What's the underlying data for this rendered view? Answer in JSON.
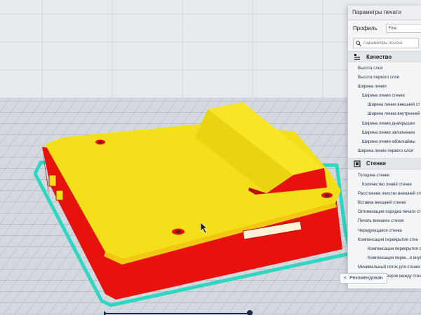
{
  "window": {
    "title": "Параметры печати"
  },
  "profile": {
    "label": "Профиль",
    "value": "Fine"
  },
  "search": {
    "placeholder": "Параметры поиска"
  },
  "sections": [
    {
      "title": "Качество",
      "icon": "quality-icon",
      "items": [
        {
          "label": "Высота слоя",
          "level": 0
        },
        {
          "label": "Высота первого слоя",
          "level": 0
        },
        {
          "label": "Ширина линии",
          "level": 0
        },
        {
          "label": "Ширина линии стенки",
          "level": 1
        },
        {
          "label": "Ширина линии внешней ст",
          "level": 2
        },
        {
          "label": "Ширина линии внутренней",
          "level": 2
        },
        {
          "label": "Ширина линии дна/крышки",
          "level": 1
        },
        {
          "label": "Ширина линии заполнения",
          "level": 1
        },
        {
          "label": "Ширина линии юбки/каймы",
          "level": 1
        },
        {
          "label": "Ширина линии первого слоя",
          "level": 0
        }
      ]
    },
    {
      "title": "Стенки",
      "icon": "walls-icon",
      "items": [
        {
          "label": "Толщина стенки",
          "level": 0
        },
        {
          "label": "Количество линий стенки",
          "level": 1
        },
        {
          "label": "Расстояние очистки внешней стенки",
          "level": 0
        },
        {
          "label": "Вставка внешней стенки",
          "level": 0
        },
        {
          "label": "Оптимизация порядка печати стенок",
          "level": 0
        },
        {
          "label": "Печать внешних стенок",
          "level": 0
        },
        {
          "label": "Чередующаяся стенка",
          "level": 0
        },
        {
          "label": "Компенсация перекрытия стен",
          "level": 0
        },
        {
          "label": "Компенсация перекрытия стен",
          "level": 2
        },
        {
          "label": "Компенсация перек...я внутренних",
          "level": 2
        },
        {
          "label": "Минимальный поток для стенки",
          "level": 0
        },
        {
          "label": "Заполнение зазоров между стенками",
          "level": 0
        }
      ]
    }
  ],
  "footer": {
    "recommended_label": "Рекомендован"
  },
  "colors": {
    "model_top": "#f5e11a",
    "model_side": "#e8120c",
    "skirt": "#2fd6c0",
    "build_plate": "#d4d9e0",
    "grid_line": "#9aa4b0"
  }
}
